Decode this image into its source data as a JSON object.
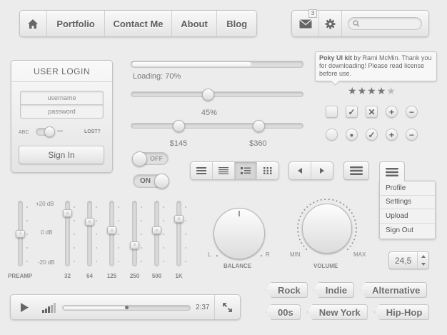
{
  "nav": {
    "items": [
      "Portfolio",
      "Contact Me",
      "About",
      "Blog"
    ]
  },
  "header": {
    "mail_badge": "3",
    "search_placeholder": ""
  },
  "tooltip": {
    "bold": "Poky UI kit",
    "text": " by Rami McMin. Thank you for downloading! Please read license before use."
  },
  "rating": {
    "value": 4,
    "max": 5
  },
  "login": {
    "title": "USER LOGIN",
    "username_placeholder": "username",
    "password_placeholder": "password",
    "toggle_left": "ABC",
    "toggle_right": "***",
    "lost_label": "LOST?",
    "button": "Sign In"
  },
  "progress": {
    "label": "Loading: 70%",
    "value": 0.7
  },
  "slider_single": {
    "label": "45%",
    "value": 0.45
  },
  "slider_range": {
    "min_label": "$145",
    "max_label": "$360",
    "min_value": 0.28,
    "max_value": 0.74
  },
  "toggles": {
    "off": "OFF",
    "on": "ON"
  },
  "checkboxes": {
    "row1": [
      "empty",
      "check",
      "cross",
      "plus",
      "minus"
    ],
    "row2": [
      "empty",
      "dot",
      "check",
      "plus",
      "minus"
    ]
  },
  "eq": {
    "db_labels": [
      "+20 dB",
      "0 dB",
      "-20 dB"
    ],
    "preamp_label": "PREAMP",
    "bands": [
      {
        "label": "32",
        "level": 0.85
      },
      {
        "label": "64",
        "level": 0.7
      },
      {
        "label": "125",
        "level": 0.55
      },
      {
        "label": "250",
        "level": 0.3
      },
      {
        "label": "500",
        "level": 0.55
      },
      {
        "label": "1K",
        "level": 0.75
      }
    ],
    "preamp_level": 0.5
  },
  "knobs": {
    "balance": {
      "label": "BALANCE",
      "left": "L",
      "right": "R"
    },
    "volume": {
      "label": "VOLUME",
      "min": "MIN",
      "max": "MAX"
    }
  },
  "stepper": {
    "value": "24,5"
  },
  "dropdown": {
    "items": [
      "Profile",
      "Settings",
      "Upload",
      "Sign Out"
    ]
  },
  "player": {
    "time": "2:37",
    "progress": 0.5
  },
  "tags": {
    "row1": [
      "Rock",
      "Indie",
      "Alternative"
    ],
    "row2": [
      "00s",
      "New York",
      "Hip-Hop"
    ]
  },
  "icons": {
    "home": "home-icon",
    "mail": "envelope-icon",
    "settings": "gear-icon",
    "search": "search-icon",
    "play": "play-icon",
    "volume": "volume-bars-icon",
    "fullscreen": "fullscreen-icon",
    "menu": "hamburger-icon"
  }
}
